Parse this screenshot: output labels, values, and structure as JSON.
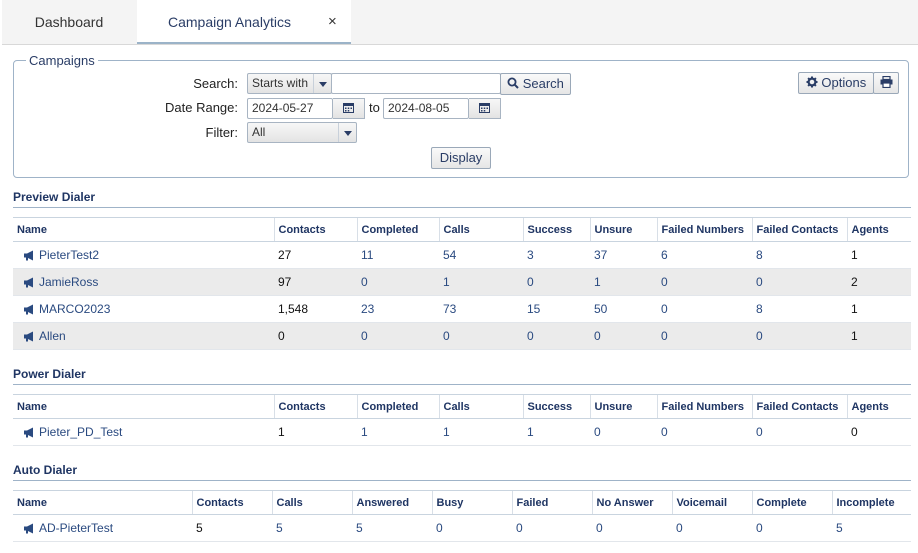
{
  "tabs": {
    "dashboard": "Dashboard",
    "analytics": "Campaign Analytics",
    "close": "×"
  },
  "campaigns": {
    "legend": "Campaigns",
    "search_label": "Search:",
    "search_mode": "Starts with",
    "search_value": "",
    "search_button": "Search",
    "date_label": "Date Range:",
    "date_from": "2024-05-27",
    "to_label": "to",
    "date_to": "2024-08-05",
    "filter_label": "Filter:",
    "filter_value": "All",
    "display_button": "Display",
    "options_button": "Options"
  },
  "preview": {
    "title": "Preview Dialer",
    "headers": [
      "Name",
      "Contacts",
      "Completed",
      "Calls",
      "Success",
      "Unsure",
      "Failed Numbers",
      "Failed Contacts",
      "Agents"
    ],
    "rows": [
      [
        "PieterTest2",
        "27",
        "11",
        "54",
        "3",
        "37",
        "6",
        "8",
        "1"
      ],
      [
        "JamieRoss",
        "97",
        "0",
        "1",
        "0",
        "1",
        "0",
        "0",
        "2"
      ],
      [
        "MARCO2023",
        "1,548",
        "23",
        "73",
        "15",
        "50",
        "0",
        "8",
        "1"
      ],
      [
        "Allen",
        "0",
        "0",
        "0",
        "0",
        "0",
        "0",
        "0",
        "1"
      ]
    ]
  },
  "power": {
    "title": "Power Dialer",
    "headers": [
      "Name",
      "Contacts",
      "Completed",
      "Calls",
      "Success",
      "Unsure",
      "Failed Numbers",
      "Failed Contacts",
      "Agents"
    ],
    "rows": [
      [
        "Pieter_PD_Test",
        "1",
        "1",
        "1",
        "1",
        "0",
        "0",
        "0",
        "0"
      ]
    ]
  },
  "auto": {
    "title": "Auto Dialer",
    "headers": [
      "Name",
      "Contacts",
      "Calls",
      "Answered",
      "Busy",
      "Failed",
      "No Answer",
      "Voicemail",
      "Complete",
      "Incomplete"
    ],
    "rows": [
      [
        "AD-PieterTest",
        "5",
        "5",
        "5",
        "0",
        "0",
        "0",
        "0",
        "0",
        "5"
      ]
    ]
  },
  "icons": {
    "search": "search-icon",
    "calendar": "calendar-icon",
    "gear": "gear-icon",
    "print": "print-icon",
    "campaign": "megaphone-icon"
  }
}
